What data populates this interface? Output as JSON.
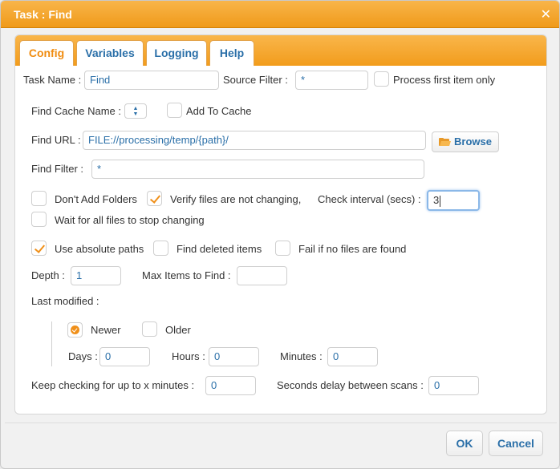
{
  "window": {
    "title": "Task : Find",
    "close_symbol": "✕"
  },
  "tabs": [
    {
      "label": "Config",
      "active": true
    },
    {
      "label": "Variables",
      "active": false
    },
    {
      "label": "Logging",
      "active": false
    },
    {
      "label": "Help",
      "active": false
    }
  ],
  "form": {
    "task_name_label": "Task Name :",
    "task_name_value": "Find",
    "source_filter_label": "Source Filter :",
    "source_filter_value": "*",
    "process_first_label": "Process first item only",
    "process_first_checked": false,
    "find_cache_label": "Find Cache Name :",
    "add_to_cache_label": "Add To Cache",
    "add_to_cache_checked": false,
    "find_url_label": "Find URL :",
    "find_url_value": "FILE://processing/temp/{path}/",
    "browse_label": "Browse",
    "find_filter_label": "Find Filter :",
    "find_filter_value": "*",
    "dont_add_folders_label": "Don't Add Folders",
    "dont_add_folders_checked": false,
    "verify_files_label": "Verify files are not changing,",
    "verify_files_checked": true,
    "check_interval_label": "Check interval (secs) :",
    "check_interval_value": "3",
    "wait_all_files_label": "Wait for all files to stop changing",
    "wait_all_files_checked": false,
    "use_absolute_label": "Use absolute paths",
    "use_absolute_checked": true,
    "find_deleted_label": "Find deleted items",
    "find_deleted_checked": false,
    "fail_no_files_label": "Fail if no files are found",
    "fail_no_files_checked": false,
    "depth_label": "Depth :",
    "depth_value": "1",
    "max_items_label": "Max Items to Find :",
    "max_items_value": "",
    "last_modified_label": "Last modified :",
    "newer_label": "Newer",
    "newer_selected": true,
    "older_label": "Older",
    "older_selected": false,
    "days_label": "Days :",
    "days_value": "0",
    "hours_label": "Hours :",
    "hours_value": "0",
    "minutes_label": "Minutes :",
    "minutes_value": "0",
    "keep_checking_label": "Keep checking for up to x minutes :",
    "keep_checking_value": "0",
    "seconds_delay_label": "Seconds delay between scans :",
    "seconds_delay_value": "0"
  },
  "footer": {
    "ok_label": "OK",
    "cancel_label": "Cancel"
  },
  "colors": {
    "accent": "#f29c1c",
    "link_blue": "#2a6fa8",
    "check": "#f0901a"
  },
  "icons": {
    "close": "close-icon",
    "browse": "folder-open-icon",
    "spinner": "spinner-arrows-icon"
  }
}
